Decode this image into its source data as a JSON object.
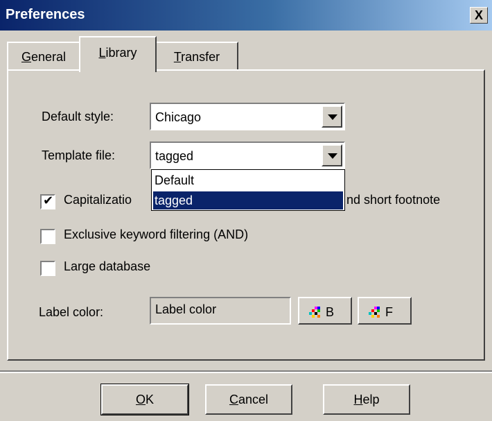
{
  "window": {
    "title": "Preferences",
    "close_label": "X"
  },
  "tabs": [
    {
      "label": "General",
      "key": "G",
      "rest": "eneral",
      "active": false
    },
    {
      "label": "Library",
      "key": "L",
      "rest": "ibrary",
      "active": true
    },
    {
      "label": "Transfer",
      "key": "T",
      "rest": "ransfer",
      "active": false
    }
  ],
  "library": {
    "default_style": {
      "label": "Default style:",
      "value": "Chicago"
    },
    "template_file": {
      "label": "Template file:",
      "value": "tagged",
      "options": [
        "Default",
        "tagged"
      ],
      "selected_option": "tagged",
      "expanded": true
    },
    "checkboxes": [
      {
        "label_left": "Capitalizatio",
        "label_right": "nd short footnote",
        "checked": true,
        "check_mark": "✔"
      },
      {
        "label": "Exclusive keyword filtering (AND)",
        "checked": false
      },
      {
        "label": "Large database",
        "checked": false
      }
    ],
    "label_color": {
      "label": "Label color:",
      "field_value": "Label color",
      "buttons": [
        {
          "label": "B"
        },
        {
          "label": "F"
        }
      ]
    }
  },
  "footer": {
    "ok": {
      "key": "O",
      "rest": "K"
    },
    "cancel": {
      "key": "C",
      "rest": "ancel"
    },
    "help": {
      "key": "H",
      "rest": "elp"
    }
  },
  "colors": {
    "title_start": "#0a246a",
    "title_end": "#a6caf0",
    "face": "#d4d0c8",
    "selection": "#0a246a"
  }
}
